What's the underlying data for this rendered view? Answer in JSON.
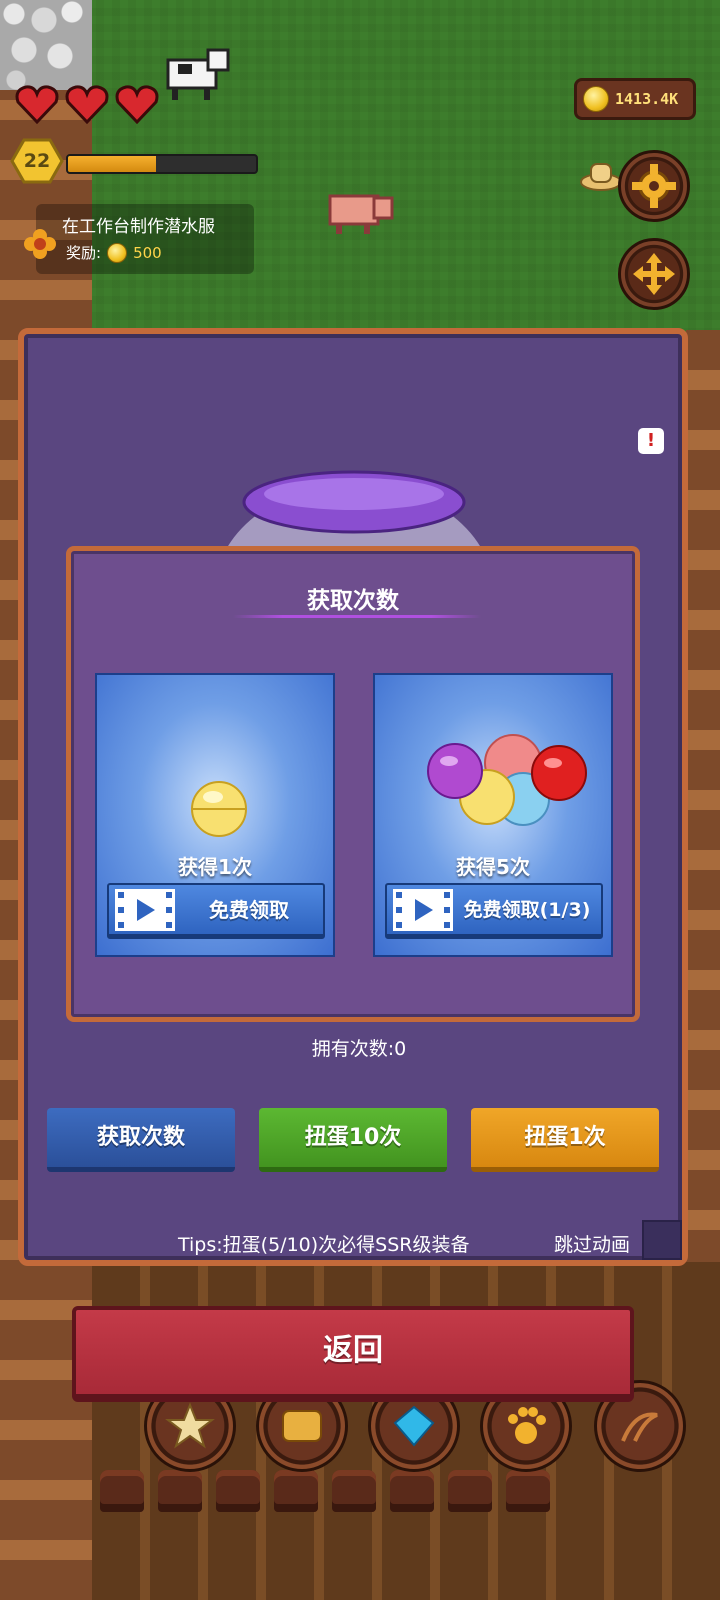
{
  "hud": {
    "level": "22",
    "xp_progress": 0.47,
    "coins": "1413.4K",
    "hearts": 3
  },
  "quest": {
    "title": "在工作台制作潜水服",
    "reward_label": "奖励:",
    "reward_value": "500"
  },
  "popup": {
    "title": "获取次数",
    "options": [
      {
        "label": "获得1次",
        "button": "免费领取"
      },
      {
        "label": "获得5次",
        "button": "免费领取(1/3)"
      }
    ]
  },
  "gacha": {
    "owned": "拥有次数:0",
    "buttons": {
      "get_count": "获取次数",
      "spin10": "扭蛋10次",
      "spin1": "扭蛋1次"
    },
    "tips": "Tips:扭蛋(5/10)次必得SSR级装备",
    "skip": "跳过动画",
    "alert": "!"
  },
  "back": "返回",
  "colors": {
    "panel": "#5a4680",
    "popup": "#6e4e8e",
    "border": "#c46a3a",
    "btn_blue": "#2b509a",
    "btn_green": "#439420",
    "btn_orange": "#d88810",
    "btn_red": "#a82a38"
  },
  "icons": [
    "heart-icon",
    "level-hex-icon",
    "coin-icon",
    "gear-icon",
    "move-arrows-icon",
    "video-icon",
    "star-icon",
    "map-icon",
    "gem-icon",
    "paw-icon",
    "whip-icon"
  ]
}
